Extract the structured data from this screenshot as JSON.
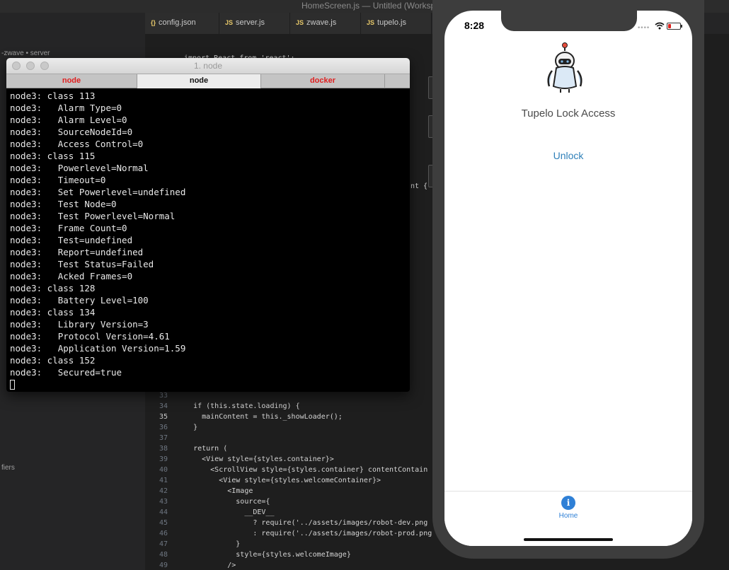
{
  "vscode": {
    "window_title": "HomeScreen.js — Untitled (Workspace)",
    "sidebar_labels": [
      "-zwave • server",
      "fiers"
    ],
    "tabs": [
      {
        "icon": "{}",
        "label": "config.json"
      },
      {
        "icon": "JS",
        "label": "server.js"
      },
      {
        "icon": "JS",
        "label": "zwave.js"
      },
      {
        "icon": "JS",
        "label": "tupelo.js"
      }
    ],
    "partial_code_first": "import React from 'react';",
    "partial_code_mid": "nt {",
    "code_lines": [
      {
        "num": "33",
        "text": ""
      },
      {
        "num": "34",
        "text": "    if (this.state.loading) {"
      },
      {
        "num": "35",
        "text": "      mainContent = this._showLoader();"
      },
      {
        "num": "36",
        "text": "    }"
      },
      {
        "num": "37",
        "text": ""
      },
      {
        "num": "38",
        "text": "    return ("
      },
      {
        "num": "39",
        "text": "      <View style={styles.container}>"
      },
      {
        "num": "40",
        "text": "        <ScrollView style={styles.container} contentContain"
      },
      {
        "num": "41",
        "text": "          <View style={styles.welcomeContainer}>"
      },
      {
        "num": "42",
        "text": "            <Image"
      },
      {
        "num": "43",
        "text": "              source={"
      },
      {
        "num": "44",
        "text": "                __DEV__"
      },
      {
        "num": "45",
        "text": "                  ? require('../assets/images/robot-dev.png"
      },
      {
        "num": "46",
        "text": "                  : require('../assets/images/robot-prod.png"
      },
      {
        "num": "47",
        "text": "              }"
      },
      {
        "num": "48",
        "text": "              style={styles.welcomeImage}"
      },
      {
        "num": "49",
        "text": "            />"
      }
    ],
    "active_line": "35"
  },
  "terminal": {
    "title": "1. node",
    "tabs": [
      {
        "label": "node",
        "state": "red"
      },
      {
        "label": "node",
        "state": "active"
      },
      {
        "label": "docker",
        "state": "red"
      },
      {
        "label": "",
        "state": "plain"
      }
    ],
    "lines": [
      "node3: class 113",
      "node3:   Alarm Type=0",
      "node3:   Alarm Level=0",
      "node3:   SourceNodeId=0",
      "node3:   Access Control=0",
      "node3: class 115",
      "node3:   Powerlevel=Normal",
      "node3:   Timeout=0",
      "node3:   Set Powerlevel=undefined",
      "node3:   Test Node=0",
      "node3:   Test Powerlevel=Normal",
      "node3:   Frame Count=0",
      "node3:   Test=undefined",
      "node3:   Report=undefined",
      "node3:   Test Status=Failed",
      "node3:   Acked Frames=0",
      "node3: class 128",
      "node3:   Battery Level=100",
      "node3: class 134",
      "node3:   Library Version=3",
      "node3:   Protocol Version=4.61",
      "node3:   Application Version=1.59",
      "node3: class 152",
      "node3:   Secured=true"
    ]
  },
  "phone": {
    "time": "8:28",
    "app_title": "Tupelo Lock Access",
    "unlock_label": "Unlock",
    "home_tab_label": "Home",
    "home_icon_glyph": "i",
    "accent_color": "#2f80d6",
    "battery": "low"
  }
}
